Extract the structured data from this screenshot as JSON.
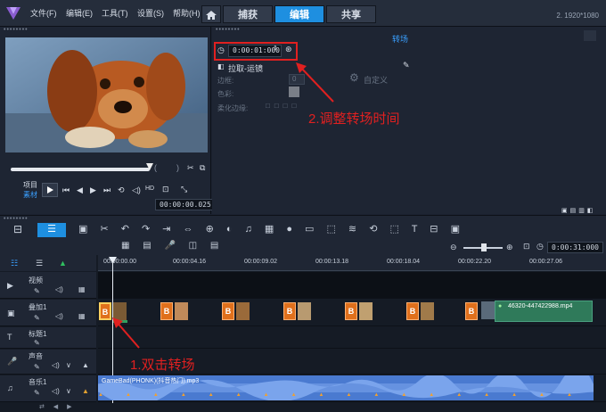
{
  "menu": [
    "文件(F)",
    "编辑(E)",
    "工具(T)",
    "设置(S)",
    "帮助(H)"
  ],
  "tabs": {
    "capture": "捕获",
    "edit": "编辑",
    "share": "共享"
  },
  "resolution": "2. 1920*1080",
  "preview": {
    "project_label": "项目",
    "clip_label": "素材",
    "timecode": "00:00:00.025",
    "ratio_icon": "aspect-ratio-icon"
  },
  "options": {
    "title": "转场",
    "duration": "0:00:01:000",
    "effect_name": "拉取-运镜",
    "border_label": "边框:",
    "border_value": "0",
    "color_label": "色彩:",
    "soft_edge_label": "柔化边缘:",
    "custom_label": "自定义"
  },
  "annotations": {
    "step2": "2.调整转场时间",
    "step1": "1.双击转场"
  },
  "toolbar": {
    "timecode": "0:00:31:000"
  },
  "ruler": [
    "00:00:00.00",
    "00:00:04.16",
    "00:00:09.02",
    "00:00:13.18",
    "00:00:18.04",
    "00:00:22.20",
    "00:00:27.06"
  ],
  "tracks": {
    "video": "视频",
    "overlay": "叠加1",
    "title": "标题1",
    "voice": "声音",
    "music": "音乐1"
  },
  "overlay_clip_name": "46320-447422988.mp4",
  "music_clip_name": "GameBad(PHONK)(抖音热门).mp3",
  "colors": {
    "accent": "#1e8fe0",
    "annotation": "#e02020",
    "transition": "#e0701c",
    "audio": "#5a86d8"
  }
}
